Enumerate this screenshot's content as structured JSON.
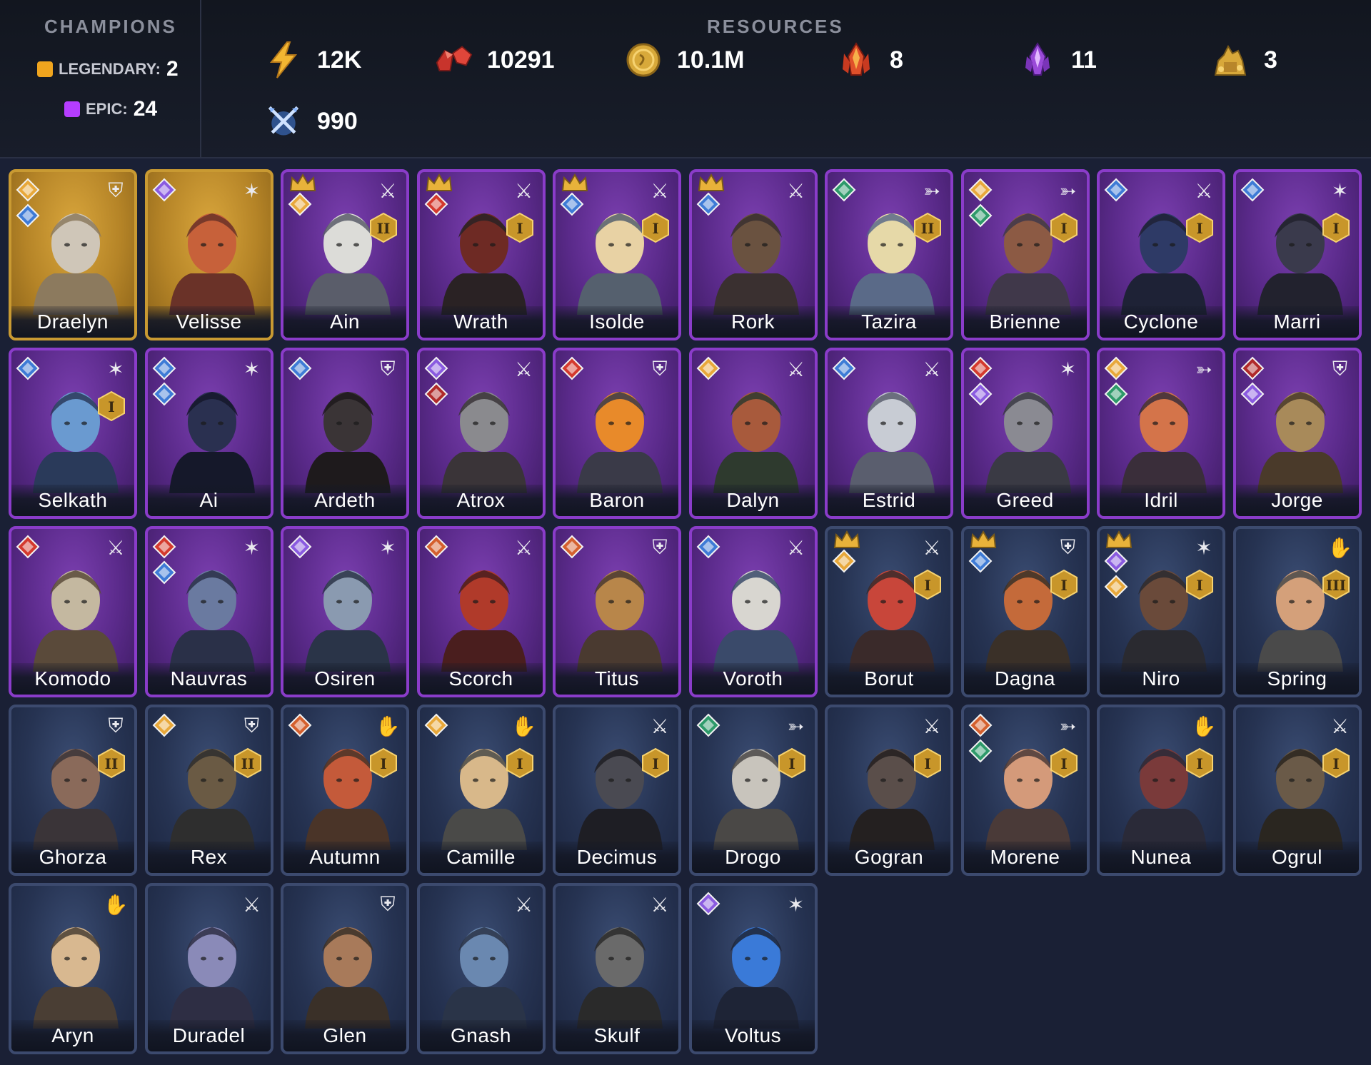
{
  "header": {
    "champions_title": "CHAMPIONS",
    "resources_title": "RESOURCES",
    "legendary": {
      "label": "LEGENDARY:",
      "count": "2",
      "color": "#f0a51e"
    },
    "epic": {
      "label": "EPIC:",
      "count": "24",
      "color": "#b53dff"
    }
  },
  "resources": [
    {
      "name": "energy",
      "icon": "lightning-icon",
      "value": "12K"
    },
    {
      "name": "rubies",
      "icon": "ruby-icon",
      "value": "10291"
    },
    {
      "name": "gold",
      "icon": "gold-coin-icon",
      "value": "10.1M"
    },
    {
      "name": "fire-crystal",
      "icon": "fire-crystal-icon",
      "value": "8"
    },
    {
      "name": "void-crystal",
      "icon": "void-crystal-icon",
      "value": "11"
    },
    {
      "name": "gold-heap",
      "icon": "treasure-icon",
      "value": "3"
    },
    {
      "name": "arena-tokens",
      "icon": "crossed-swords-icon",
      "value": "990"
    }
  ],
  "champions": [
    {
      "name": "Draelyn",
      "rarity": "legendary",
      "role": "defense",
      "affinities": [
        "#e8a83a",
        "#3e7bd6"
      ],
      "crown": false,
      "asc": 0,
      "portrait": "#cfc6b8",
      "shade": "#8c7a5e"
    },
    {
      "name": "Velisse",
      "rarity": "legendary",
      "role": "support",
      "affinities": [
        "#8a5be0"
      ],
      "crown": false,
      "asc": 0,
      "portrait": "#c7613a",
      "shade": "#6a3228"
    },
    {
      "name": "Ain",
      "rarity": "epic",
      "role": "attack",
      "affinities": [
        "#e8a83a"
      ],
      "crown": true,
      "asc": 2,
      "portrait": "#dcdcd8",
      "shade": "#5a5d6a"
    },
    {
      "name": "Wrath",
      "rarity": "epic",
      "role": "attack",
      "affinities": [
        "#d43a2e"
      ],
      "crown": true,
      "asc": 1,
      "portrait": "#6e2a24",
      "shade": "#2a2224"
    },
    {
      "name": "Isolde",
      "rarity": "epic",
      "role": "attack",
      "affinities": [
        "#3e7bd6"
      ],
      "crown": true,
      "asc": 1,
      "portrait": "#e8d2a4",
      "shade": "#55606e"
    },
    {
      "name": "Rork",
      "rarity": "epic",
      "role": "attack",
      "affinities": [
        "#3e7bd6"
      ],
      "crown": true,
      "asc": 0,
      "portrait": "#6a5240",
      "shade": "#3a3030"
    },
    {
      "name": "Tazira",
      "rarity": "epic",
      "role": "ranged",
      "affinities": [
        "#2e9a6a"
      ],
      "crown": false,
      "asc": 2,
      "portrait": "#e6d9a8",
      "shade": "#5a6a88"
    },
    {
      "name": "Brienne",
      "rarity": "epic",
      "role": "ranged",
      "affinities": [
        "#e8a83a",
        "#2e9a6a"
      ],
      "crown": false,
      "asc": 1,
      "portrait": "#8c5a44",
      "shade": "#40384a"
    },
    {
      "name": "Cyclone",
      "rarity": "epic",
      "role": "attack",
      "affinities": [
        "#3e7bd6"
      ],
      "crown": false,
      "asc": 1,
      "portrait": "#2e3a66",
      "shade": "#1e2236"
    },
    {
      "name": "Marri",
      "rarity": "epic",
      "role": "support",
      "affinities": [
        "#3e7bd6"
      ],
      "crown": false,
      "asc": 1,
      "portrait": "#3a3a4c",
      "shade": "#22222e"
    },
    {
      "name": "Selkath",
      "rarity": "epic",
      "role": "support",
      "affinities": [
        "#3e7bd6"
      ],
      "crown": false,
      "asc": 1,
      "portrait": "#6a9ad0",
      "shade": "#2a3a5a"
    },
    {
      "name": "Ai",
      "rarity": "epic",
      "role": "support",
      "affinities": [
        "#3e7bd6",
        "#3e7bd6"
      ],
      "crown": false,
      "asc": 0,
      "portrait": "#2a3050",
      "shade": "#15182a"
    },
    {
      "name": "Ardeth",
      "rarity": "epic",
      "role": "defense",
      "affinities": [
        "#3e7bd6"
      ],
      "crown": false,
      "asc": 0,
      "portrait": "#3a3436",
      "shade": "#1e1a1c"
    },
    {
      "name": "Atrox",
      "rarity": "epic",
      "role": "attack",
      "affinities": [
        "#8a5be0",
        "#b02a2a"
      ],
      "crown": false,
      "asc": 0,
      "portrait": "#8a8a8e",
      "shade": "#3a3438"
    },
    {
      "name": "Baron",
      "rarity": "epic",
      "role": "defense",
      "affinities": [
        "#d43a2e"
      ],
      "crown": false,
      "asc": 0,
      "portrait": "#e88a2a",
      "shade": "#3a3a48"
    },
    {
      "name": "Dalyn",
      "rarity": "epic",
      "role": "attack",
      "affinities": [
        "#e8a83a"
      ],
      "crown": false,
      "asc": 0,
      "portrait": "#a85a3c",
      "shade": "#2e3a2e"
    },
    {
      "name": "Estrid",
      "rarity": "epic",
      "role": "attack",
      "affinities": [
        "#3e7bd6"
      ],
      "crown": false,
      "asc": 0,
      "portrait": "#c8ccd4",
      "shade": "#5a5e6e"
    },
    {
      "name": "Greed",
      "rarity": "epic",
      "role": "support",
      "affinities": [
        "#d43a2e",
        "#8a5be0"
      ],
      "crown": false,
      "asc": 0,
      "portrait": "#8a8a92",
      "shade": "#3a3a44"
    },
    {
      "name": "Idril",
      "rarity": "epic",
      "role": "ranged",
      "affinities": [
        "#e8a83a",
        "#2e9a6a"
      ],
      "crown": false,
      "asc": 0,
      "portrait": "#d4744a",
      "shade": "#3a2e3a"
    },
    {
      "name": "Jorge",
      "rarity": "epic",
      "role": "defense",
      "affinities": [
        "#b02a2a",
        "#8a5be0"
      ],
      "crown": false,
      "asc": 0,
      "portrait": "#a88a5a",
      "shade": "#4a3a2a"
    },
    {
      "name": "Komodo",
      "rarity": "epic",
      "role": "attack",
      "affinities": [
        "#d43a2e"
      ],
      "crown": false,
      "asc": 0,
      "portrait": "#c4b8a0",
      "shade": "#5a4a3a"
    },
    {
      "name": "Nauvras",
      "rarity": "epic",
      "role": "support",
      "affinities": [
        "#d43a2e",
        "#3e7bd6"
      ],
      "crown": false,
      "asc": 0,
      "portrait": "#6a7aa0",
      "shade": "#2a3048"
    },
    {
      "name": "Osiren",
      "rarity": "epic",
      "role": "support",
      "affinities": [
        "#8a5be0"
      ],
      "crown": false,
      "asc": 0,
      "portrait": "#8a9ab0",
      "shade": "#2a3448"
    },
    {
      "name": "Scorch",
      "rarity": "epic",
      "role": "attack",
      "affinities": [
        "#d4602e"
      ],
      "crown": false,
      "asc": 0,
      "portrait": "#b03a2a",
      "shade": "#4a1e1e"
    },
    {
      "name": "Titus",
      "rarity": "epic",
      "role": "defense",
      "affinities": [
        "#d4602e"
      ],
      "crown": false,
      "asc": 0,
      "portrait": "#b8864a",
      "shade": "#4a3a30"
    },
    {
      "name": "Voroth",
      "rarity": "epic",
      "role": "attack",
      "affinities": [
        "#3e7bd6"
      ],
      "crown": false,
      "asc": 0,
      "portrait": "#d8d6d0",
      "shade": "#3a4a6a"
    },
    {
      "name": "Borut",
      "rarity": "rare",
      "role": "attack",
      "affinities": [
        "#e8a83a"
      ],
      "crown": true,
      "asc": 1,
      "portrait": "#c8463a",
      "shade": "#3a2a2a"
    },
    {
      "name": "Dagna",
      "rarity": "rare",
      "role": "defense",
      "affinities": [
        "#3e7bd6"
      ],
      "crown": true,
      "asc": 1,
      "portrait": "#c46a3a",
      "shade": "#3a3028"
    },
    {
      "name": "Niro",
      "rarity": "rare",
      "role": "support",
      "affinities": [
        "#8a5be0",
        "#e8a83a"
      ],
      "crown": true,
      "asc": 1,
      "portrait": "#6a4a3a",
      "shade": "#2a2a30"
    },
    {
      "name": "Spring",
      "rarity": "rare",
      "role": "healer",
      "affinities": [],
      "crown": false,
      "asc": 3,
      "portrait": "#d4a07a",
      "shade": "#4a4a4a"
    },
    {
      "name": "Ghorza",
      "rarity": "rare",
      "role": "defense",
      "affinities": [],
      "crown": false,
      "asc": 2,
      "portrait": "#8a6a5a",
      "shade": "#3a3438"
    },
    {
      "name": "Rex",
      "rarity": "rare",
      "role": "defense",
      "affinities": [
        "#e8a83a"
      ],
      "crown": false,
      "asc": 2,
      "portrait": "#6a5a44",
      "shade": "#2e2e2e"
    },
    {
      "name": "Autumn",
      "rarity": "rare",
      "role": "healer",
      "affinities": [
        "#d4602e"
      ],
      "crown": false,
      "asc": 1,
      "portrait": "#c45a3a",
      "shade": "#4a3428"
    },
    {
      "name": "Camille",
      "rarity": "rare",
      "role": "healer",
      "affinities": [
        "#e8a83a"
      ],
      "crown": false,
      "asc": 1,
      "portrait": "#d8b88a",
      "shade": "#4a4a48"
    },
    {
      "name": "Decimus",
      "rarity": "rare",
      "role": "attack",
      "affinities": [],
      "crown": false,
      "asc": 1,
      "portrait": "#4a4a52",
      "shade": "#1e1e24"
    },
    {
      "name": "Drogo",
      "rarity": "rare",
      "role": "ranged",
      "affinities": [
        "#2e9a6a"
      ],
      "crown": false,
      "asc": 1,
      "portrait": "#c8c4bc",
      "shade": "#4a4846"
    },
    {
      "name": "Gogran",
      "rarity": "rare",
      "role": "attack",
      "affinities": [],
      "crown": false,
      "asc": 1,
      "portrait": "#5a4e4a",
      "shade": "#242020"
    },
    {
      "name": "Morene",
      "rarity": "rare",
      "role": "ranged",
      "affinities": [
        "#d4602e",
        "#2e9a6a"
      ],
      "crown": false,
      "asc": 1,
      "portrait": "#d49a7a",
      "shade": "#4a3a38"
    },
    {
      "name": "Nunea",
      "rarity": "rare",
      "role": "healer",
      "affinities": [],
      "crown": false,
      "asc": 1,
      "portrait": "#7a3a3a",
      "shade": "#2a2a38"
    },
    {
      "name": "Ogrul",
      "rarity": "rare",
      "role": "attack",
      "affinities": [],
      "crown": false,
      "asc": 1,
      "portrait": "#6a5a48",
      "shade": "#2a2620"
    },
    {
      "name": "Aryn",
      "rarity": "rare",
      "role": "healer",
      "affinities": [],
      "crown": false,
      "asc": 0,
      "portrait": "#d8b890",
      "shade": "#4a3e34"
    },
    {
      "name": "Duradel",
      "rarity": "rare",
      "role": "attack",
      "affinities": [],
      "crown": false,
      "asc": 0,
      "portrait": "#8a8ab8",
      "shade": "#2e2e44"
    },
    {
      "name": "Glen",
      "rarity": "rare",
      "role": "defense",
      "affinities": [],
      "crown": false,
      "asc": 0,
      "portrait": "#a87a5a",
      "shade": "#3a3028"
    },
    {
      "name": "Gnash",
      "rarity": "rare",
      "role": "attack",
      "affinities": [],
      "crown": false,
      "asc": 0,
      "portrait": "#6a88b0",
      "shade": "#2a3448"
    },
    {
      "name": "Skulf",
      "rarity": "rare",
      "role": "attack",
      "affinities": [],
      "crown": false,
      "asc": 0,
      "portrait": "#6a6a6a",
      "shade": "#2a2a2a"
    },
    {
      "name": "Voltus",
      "rarity": "rare",
      "role": "support",
      "affinities": [
        "#8a5be0"
      ],
      "crown": false,
      "asc": 0,
      "portrait": "#3a7ad8",
      "shade": "#1e2436"
    }
  ]
}
